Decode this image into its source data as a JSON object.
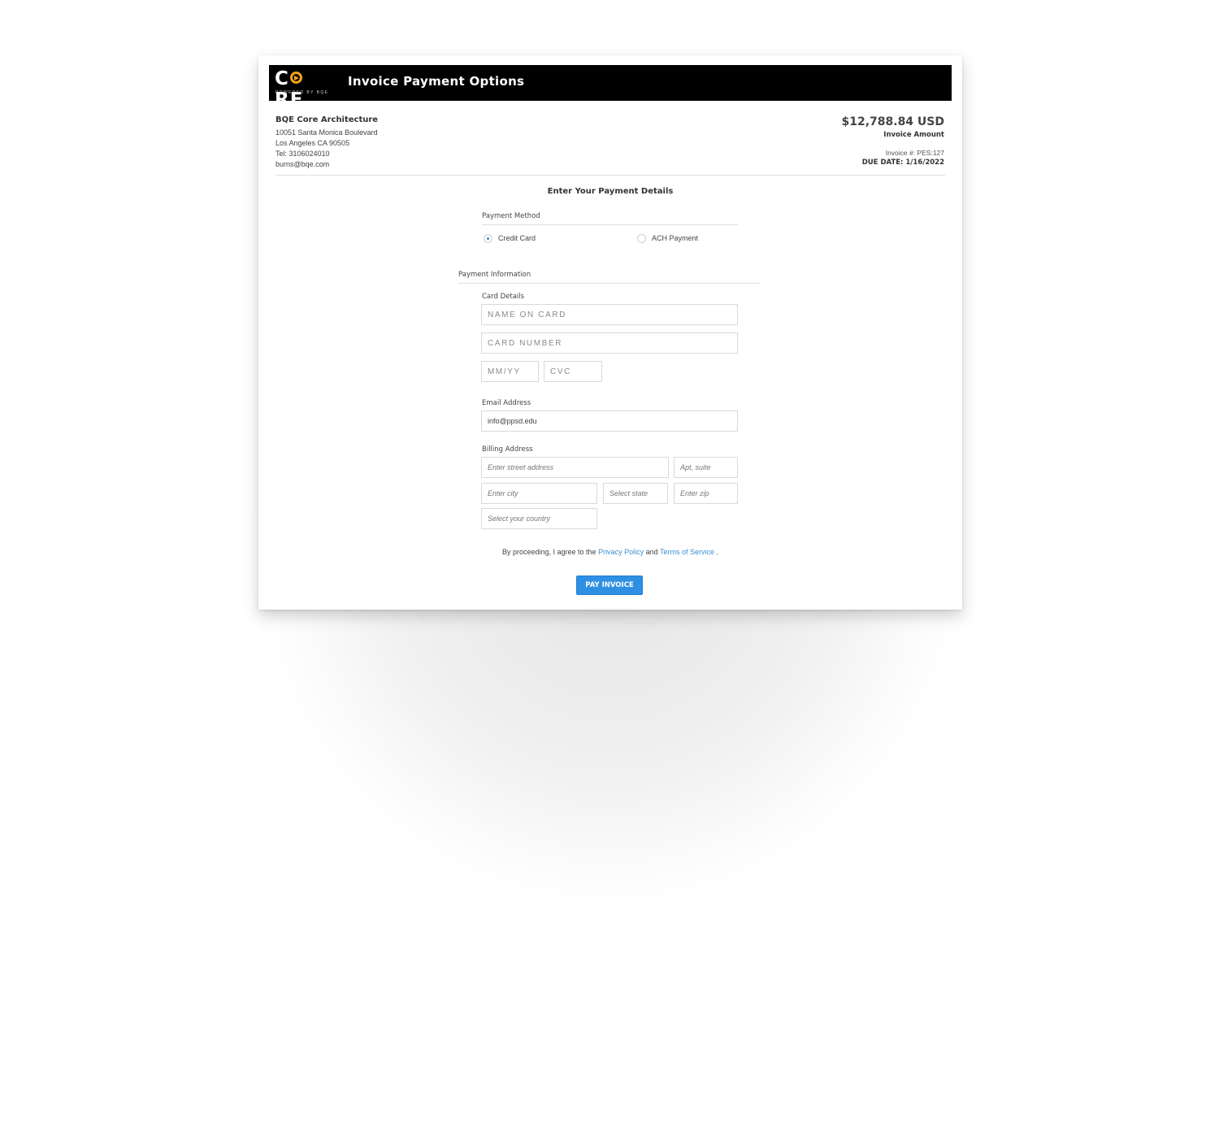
{
  "header": {
    "logo_text_c": "C",
    "logo_text_re": "RE",
    "logo_sub": "POWERED BY BQE",
    "title": "Invoice Payment Options"
  },
  "company": {
    "name": "BQE Core Architecture",
    "address1": "10051 Santa Monica Boulevard",
    "address2": "Los Angeles CA 90505",
    "tel": "Tel: 3106024010",
    "email": "burns@bqe.com"
  },
  "invoice": {
    "amount": "$12,788.84 USD",
    "amount_label": "Invoice Amount",
    "number": "Invoice #: PES:127",
    "due_date": "DUE DATE: 1/16/2022"
  },
  "form": {
    "title": "Enter Your Payment Details",
    "payment_method_label": "Payment Method",
    "options": {
      "credit_card": "Credit Card",
      "ach": "ACH Payment"
    },
    "selected_method": "Credit Card",
    "payment_info_label": "Payment Information",
    "card_details_label": "Card Details",
    "name_on_card_placeholder": "NAME ON CARD",
    "card_number_placeholder": "CARD NUMBER",
    "expiry_placeholder": "MM/YY",
    "cvc_placeholder": "CVC",
    "email_label": "Email Address",
    "email_value": "info@ppsd.edu",
    "billing_label": "Billing Address",
    "street_placeholder": "Enter street address",
    "apt_placeholder": "Apt, suite",
    "city_placeholder": "Enter city",
    "state_placeholder": "Select state",
    "zip_placeholder": "Enter zip",
    "country_placeholder": "Select your country"
  },
  "agreement": {
    "prefix": "By proceeding, I agree to the",
    "privacy": "Privacy Policy",
    "and": "and",
    "terms": "Terms of Service",
    "suffix": "."
  },
  "pay_button": "PAY INVOICE",
  "colors": {
    "accent": "#2f8fe3",
    "header_bg": "#000000",
    "logo_orange": "#f7a21b",
    "link": "#3a8fd6"
  }
}
